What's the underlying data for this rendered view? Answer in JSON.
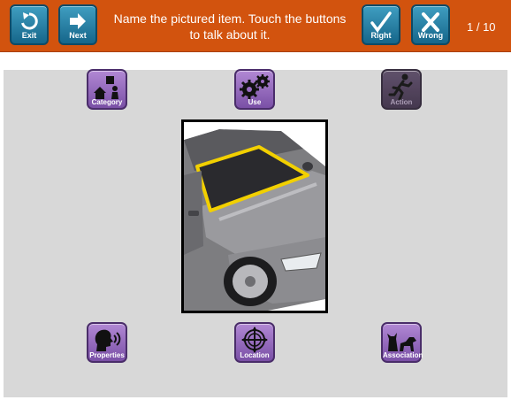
{
  "toolbar": {
    "exit_label": "Exit",
    "next_label": "Next",
    "right_label": "Right",
    "wrong_label": "Wrong"
  },
  "prompt": "Name the pictured item. Touch the buttons to talk about it.",
  "counter": "1 / 10",
  "cues": [
    {
      "label": "Category",
      "icon": "category-icon",
      "enabled": true
    },
    {
      "label": "Use",
      "icon": "gears-icon",
      "enabled": true
    },
    {
      "label": "Action",
      "icon": "runner-icon",
      "enabled": false
    },
    {
      "label": "Properties",
      "icon": "speaking-head-icon",
      "enabled": true
    },
    {
      "label": "Location",
      "icon": "compass-icon",
      "enabled": true
    },
    {
      "label": "Association",
      "icon": "cat-dog-icon",
      "enabled": true
    }
  ],
  "picture": {
    "subject": "car-windshield",
    "highlight_color": "#f2d000"
  },
  "colors": {
    "header": "#d2530e",
    "nav_button": "#1f7aa0",
    "cue_button": "#9a6cc4",
    "cue_disabled": "#4e3f5a",
    "workarea": "#d8d8d8"
  }
}
